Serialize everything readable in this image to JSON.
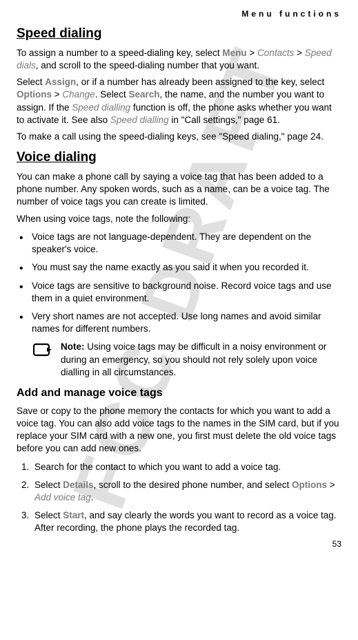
{
  "watermark": "FCC DRAFT",
  "running_head": "Menu functions",
  "page_number": "53",
  "speed_dialing": {
    "heading": "Speed dialing",
    "p1_a": "To assign a number to a speed-dialing key, select ",
    "p1_menu": "Menu",
    "p1_gt1": " > ",
    "p1_contacts": "Contacts",
    "p1_gt2": " > ",
    "p1_speeddials": "Speed dials",
    "p1_b": ", and scroll to the speed-dialing number that you want.",
    "p2_a": "Select ",
    "p2_assign": "Assign",
    "p2_b": ", or if a number has already been assigned to the key, select ",
    "p2_options": "Options",
    "p2_gt": " > ",
    "p2_change": "Change",
    "p2_c": ". Select ",
    "p2_search": "Search",
    "p2_d": ", the name, and the number you want to assign. If the ",
    "p2_sd": "Speed dialling",
    "p2_e": " function is off, the phone asks whether you want to activate it. See also ",
    "p2_sd2": "Speed dialling",
    "p2_f": " in \"Call settings,\" page 61.",
    "p3": "To make a call using the speed-dialing keys, see \"Speed dialing,\" page 24."
  },
  "voice_dialing": {
    "heading": "Voice dialing",
    "p1": "You can make a phone call by saying a voice tag that has been added to a phone number. Any spoken words, such as a name, can be a voice tag. The number of voice tags you can create is limited.",
    "p2": "When using voice tags, note the following:",
    "bullets": [
      "Voice tags are not language-dependent. They are dependent on the speaker's voice.",
      "You must say the name exactly as you said it when you recorded it.",
      "Voice tags are sensitive to background noise. Record voice tags and use them in a quiet environment.",
      "Very short names are not accepted. Use long names and avoid similar names for different numbers."
    ],
    "note_label": "Note:",
    "note_text": " Using voice tags may be difficult in a noisy environment or during an emergency, so you should not rely solely upon voice dialling in all circumstances."
  },
  "add_manage": {
    "heading": "Add and manage voice tags",
    "p1": "Save or copy to the phone memory the contacts for which you want to add a voice tag. You can also add voice tags to the names in the SIM card, but if you replace your SIM card with a new one, you first must delete the old voice tags before you can add new ones.",
    "step1": "Search for the contact to which you want to add a voice tag.",
    "step2_a": "Select ",
    "step2_details": "Details",
    "step2_b": ", scroll to the desired phone number, and select ",
    "step2_options": "Options",
    "step2_gt": " > ",
    "step2_add": "Add voice tag",
    "step2_c": ".",
    "step3_a": "Select ",
    "step3_start": "Start",
    "step3_b": ", and say clearly the words you want to record as a voice tag. After recording, the phone plays the recorded tag."
  }
}
